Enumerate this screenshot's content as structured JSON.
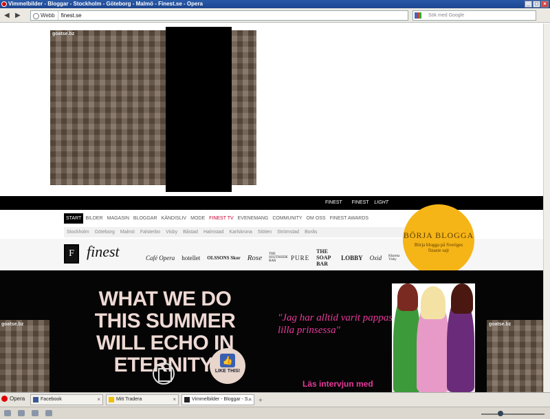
{
  "window": {
    "title": "Vimmelbilder - Bloggar - Stockholm - Göteborg - Malmö - Finest.se - Opera"
  },
  "addressbar": {
    "scheme_label": "Webb",
    "url": "finest.se",
    "search_placeholder": "Sök med Google"
  },
  "ads": {
    "left_top_label": "goatse.bz",
    "left_bottom_label": "goatse.bz",
    "right_bottom_label": "goatse.bz"
  },
  "finest": {
    "top_links": [
      "FINEST",
      "FINEST",
      "LIGHT"
    ],
    "nav": [
      "START",
      "BILDER",
      "MAGASIN",
      "BLOGGAR",
      "KÄNDISLIV",
      "MODE",
      "FINEST TV",
      "EVENEMANG",
      "COMMUNITY",
      "OM OSS",
      "FINEST AWARDS"
    ],
    "cities": [
      "Stockholm",
      "Göteborg",
      "Malmö",
      "Falsterbo",
      "Visby",
      "Båstad",
      "Halmstad",
      "Karlskrona",
      "Stöten",
      "Strömstad",
      "Borås"
    ],
    "logo_text": "finest",
    "partners": [
      "Café Opera",
      "hotellet",
      "OLSSONS Skor",
      "Rose",
      "THE SOUTHSIDE BAR",
      "PURE",
      "THE SOAP BAR",
      "LOBBY",
      "Oxid",
      "Kharma Visby"
    ],
    "blogga_title": "BÖRJA BLOGGA",
    "blogga_sub": "Börja blogga på Sveriges finaste sajt"
  },
  "banner": {
    "slogan": "WHAT WE DO THIS SUMMER WILL ECHO IN ETERNITY.",
    "like_label": "LIKE THIS!",
    "quote": "\"Jag har alltid varit pappas lilla prinsessa\"",
    "intervju": "Läs intervjun med"
  },
  "taskbar": {
    "opera_label": "Opera",
    "tabs": [
      {
        "label": "Facebook",
        "icon_color": "#3b5998"
      },
      {
        "label": "Mitt Tradera",
        "icon_color": "#f0c000"
      },
      {
        "label": "Vimmelbilder - Bloggar - S...",
        "icon_color": "#222222"
      }
    ]
  },
  "colors": {
    "accent_pink": "#e8399a",
    "blogga_yellow": "#f6b517"
  }
}
